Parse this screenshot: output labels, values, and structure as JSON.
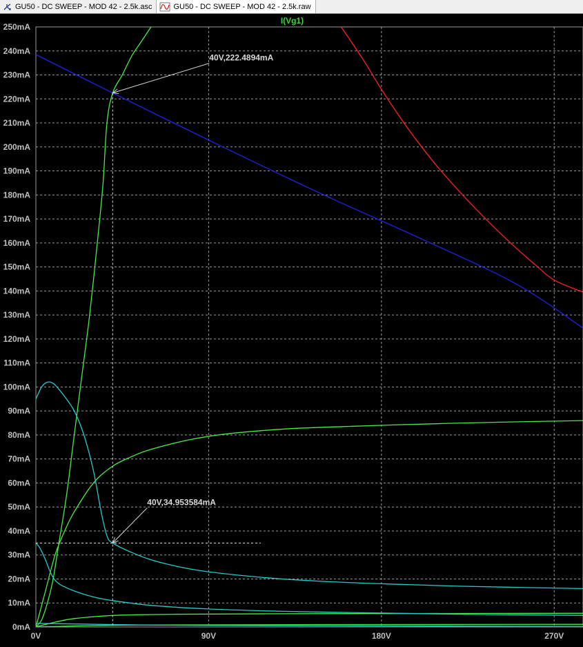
{
  "tabs": [
    {
      "label": "GU50 - DC SWEEP - MOD 42 - 2.5k.asc",
      "icon": "schematic-icon"
    },
    {
      "label": "GU50 - DC SWEEP - MOD 42 - 2.5k.raw",
      "icon": "waveform-icon"
    }
  ],
  "colors": {
    "background": "#000000",
    "grid": "#9a9a9a",
    "axis_text": "#c0c0c0",
    "title": "#33dd33",
    "cursor": "#d8d8d8"
  },
  "chart_data": {
    "type": "line",
    "title": "I(Vg1)",
    "xlim": [
      0,
      285
    ],
    "ylim": [
      0,
      250
    ],
    "x_ticks": [
      {
        "value": 0,
        "label": "0V"
      },
      {
        "value": 90,
        "label": "90V"
      },
      {
        "value": 180,
        "label": "180V"
      },
      {
        "value": 270,
        "label": "270V"
      }
    ],
    "y_ticks": [
      {
        "value": 0,
        "label": "0mA"
      },
      {
        "value": 10,
        "label": "10mA"
      },
      {
        "value": 20,
        "label": "20mA"
      },
      {
        "value": 30,
        "label": "30mA"
      },
      {
        "value": 40,
        "label": "40mA"
      },
      {
        "value": 50,
        "label": "50mA"
      },
      {
        "value": 60,
        "label": "60mA"
      },
      {
        "value": 70,
        "label": "70mA"
      },
      {
        "value": 80,
        "label": "80mA"
      },
      {
        "value": 90,
        "label": "90mA"
      },
      {
        "value": 100,
        "label": "100mA"
      },
      {
        "value": 110,
        "label": "110mA"
      },
      {
        "value": 120,
        "label": "120mA"
      },
      {
        "value": 130,
        "label": "130mA"
      },
      {
        "value": 140,
        "label": "140mA"
      },
      {
        "value": 150,
        "label": "150mA"
      },
      {
        "value": 160,
        "label": "160mA"
      },
      {
        "value": 170,
        "label": "170mA"
      },
      {
        "value": 180,
        "label": "180mA"
      },
      {
        "value": 190,
        "label": "190mA"
      },
      {
        "value": 200,
        "label": "200mA"
      },
      {
        "value": 210,
        "label": "210mA"
      },
      {
        "value": 220,
        "label": "220mA"
      },
      {
        "value": 230,
        "label": "230mA"
      },
      {
        "value": 240,
        "label": "240mA"
      },
      {
        "value": 250,
        "label": "250mA"
      }
    ],
    "grid": true,
    "series": [
      {
        "color": "#ff2020",
        "points": [
          [
            159,
            250
          ],
          [
            170,
            237
          ],
          [
            180,
            224
          ],
          [
            190,
            212
          ],
          [
            200,
            201
          ],
          [
            210,
            191
          ],
          [
            220,
            182
          ],
          [
            230,
            173.5
          ],
          [
            240,
            165.5
          ],
          [
            250,
            158
          ],
          [
            260,
            151
          ],
          [
            270,
            144.5
          ],
          [
            285,
            139.5
          ]
        ]
      },
      {
        "color": "#2222dd",
        "points": [
          [
            0,
            238.5
          ],
          [
            40,
            222.5
          ],
          [
            100,
            199
          ],
          [
            150,
            180
          ],
          [
            200,
            162
          ],
          [
            250,
            143
          ],
          [
            285,
            124.5
          ]
        ]
      },
      {
        "color": "#44ee44",
        "points": [
          [
            0,
            0
          ],
          [
            3,
            3
          ],
          [
            6,
            10
          ],
          [
            9,
            20
          ],
          [
            12,
            35
          ],
          [
            16,
            55
          ],
          [
            20,
            80
          ],
          [
            24,
            105
          ],
          [
            28,
            130
          ],
          [
            32,
            160
          ],
          [
            35,
            185
          ],
          [
            37,
            210
          ],
          [
            40,
            222.5
          ],
          [
            45,
            230
          ],
          [
            50,
            238
          ],
          [
            55,
            244
          ],
          [
            60,
            250
          ]
        ]
      },
      {
        "color": "#44ee44",
        "points": [
          [
            0,
            0
          ],
          [
            5,
            15
          ],
          [
            10,
            30
          ],
          [
            15,
            40
          ],
          [
            20,
            48
          ],
          [
            30,
            60
          ],
          [
            40,
            67
          ],
          [
            50,
            71
          ],
          [
            60,
            74
          ],
          [
            80,
            78
          ],
          [
            100,
            80.5
          ],
          [
            130,
            82.5
          ],
          [
            160,
            83.5
          ],
          [
            200,
            84.5
          ],
          [
            240,
            85.3
          ],
          [
            285,
            86
          ]
        ]
      },
      {
        "color": "#44ee44",
        "points": [
          [
            0,
            0
          ],
          [
            10,
            2
          ],
          [
            20,
            3.5
          ],
          [
            40,
            4.8
          ],
          [
            70,
            5.3
          ],
          [
            120,
            5.5
          ],
          [
            200,
            5.6
          ],
          [
            285,
            5.7
          ]
        ]
      },
      {
        "color": "#44ee44",
        "points": [
          [
            0,
            0
          ],
          [
            50,
            0.8
          ],
          [
            150,
            1
          ],
          [
            285,
            1.1
          ]
        ]
      },
      {
        "color": "#22cccc",
        "points": [
          [
            0,
            95
          ],
          [
            3,
            100
          ],
          [
            6,
            102
          ],
          [
            9,
            101.5
          ],
          [
            12,
            99
          ],
          [
            15,
            96
          ],
          [
            20,
            90
          ],
          [
            25,
            80
          ],
          [
            30,
            65
          ],
          [
            34,
            48
          ],
          [
            37,
            38
          ],
          [
            40,
            35
          ],
          [
            50,
            31
          ],
          [
            60,
            28
          ],
          [
            75,
            25
          ],
          [
            90,
            23
          ],
          [
            120,
            20.5
          ],
          [
            150,
            19
          ],
          [
            180,
            18
          ],
          [
            220,
            17
          ],
          [
            285,
            16
          ]
        ]
      },
      {
        "color": "#22cccc",
        "points": [
          [
            0,
            35
          ],
          [
            2,
            33
          ],
          [
            5,
            28
          ],
          [
            8,
            22
          ],
          [
            12,
            18
          ],
          [
            20,
            15
          ],
          [
            30,
            12.5
          ],
          [
            40,
            11
          ],
          [
            60,
            9
          ],
          [
            90,
            7.5
          ],
          [
            130,
            6.5
          ],
          [
            180,
            5.8
          ],
          [
            230,
            5.2
          ],
          [
            285,
            4.8
          ]
        ]
      },
      {
        "color": "#22cccc",
        "points": [
          [
            0,
            1.5
          ],
          [
            40,
            1
          ],
          [
            100,
            0.6
          ],
          [
            285,
            0.2
          ]
        ]
      }
    ],
    "annotations": [
      {
        "label": "40V,222.4894mA",
        "x": 40,
        "y": 222.4894
      },
      {
        "label": "40V,34.953584mA",
        "x": 40,
        "y": 34.953584
      }
    ]
  }
}
